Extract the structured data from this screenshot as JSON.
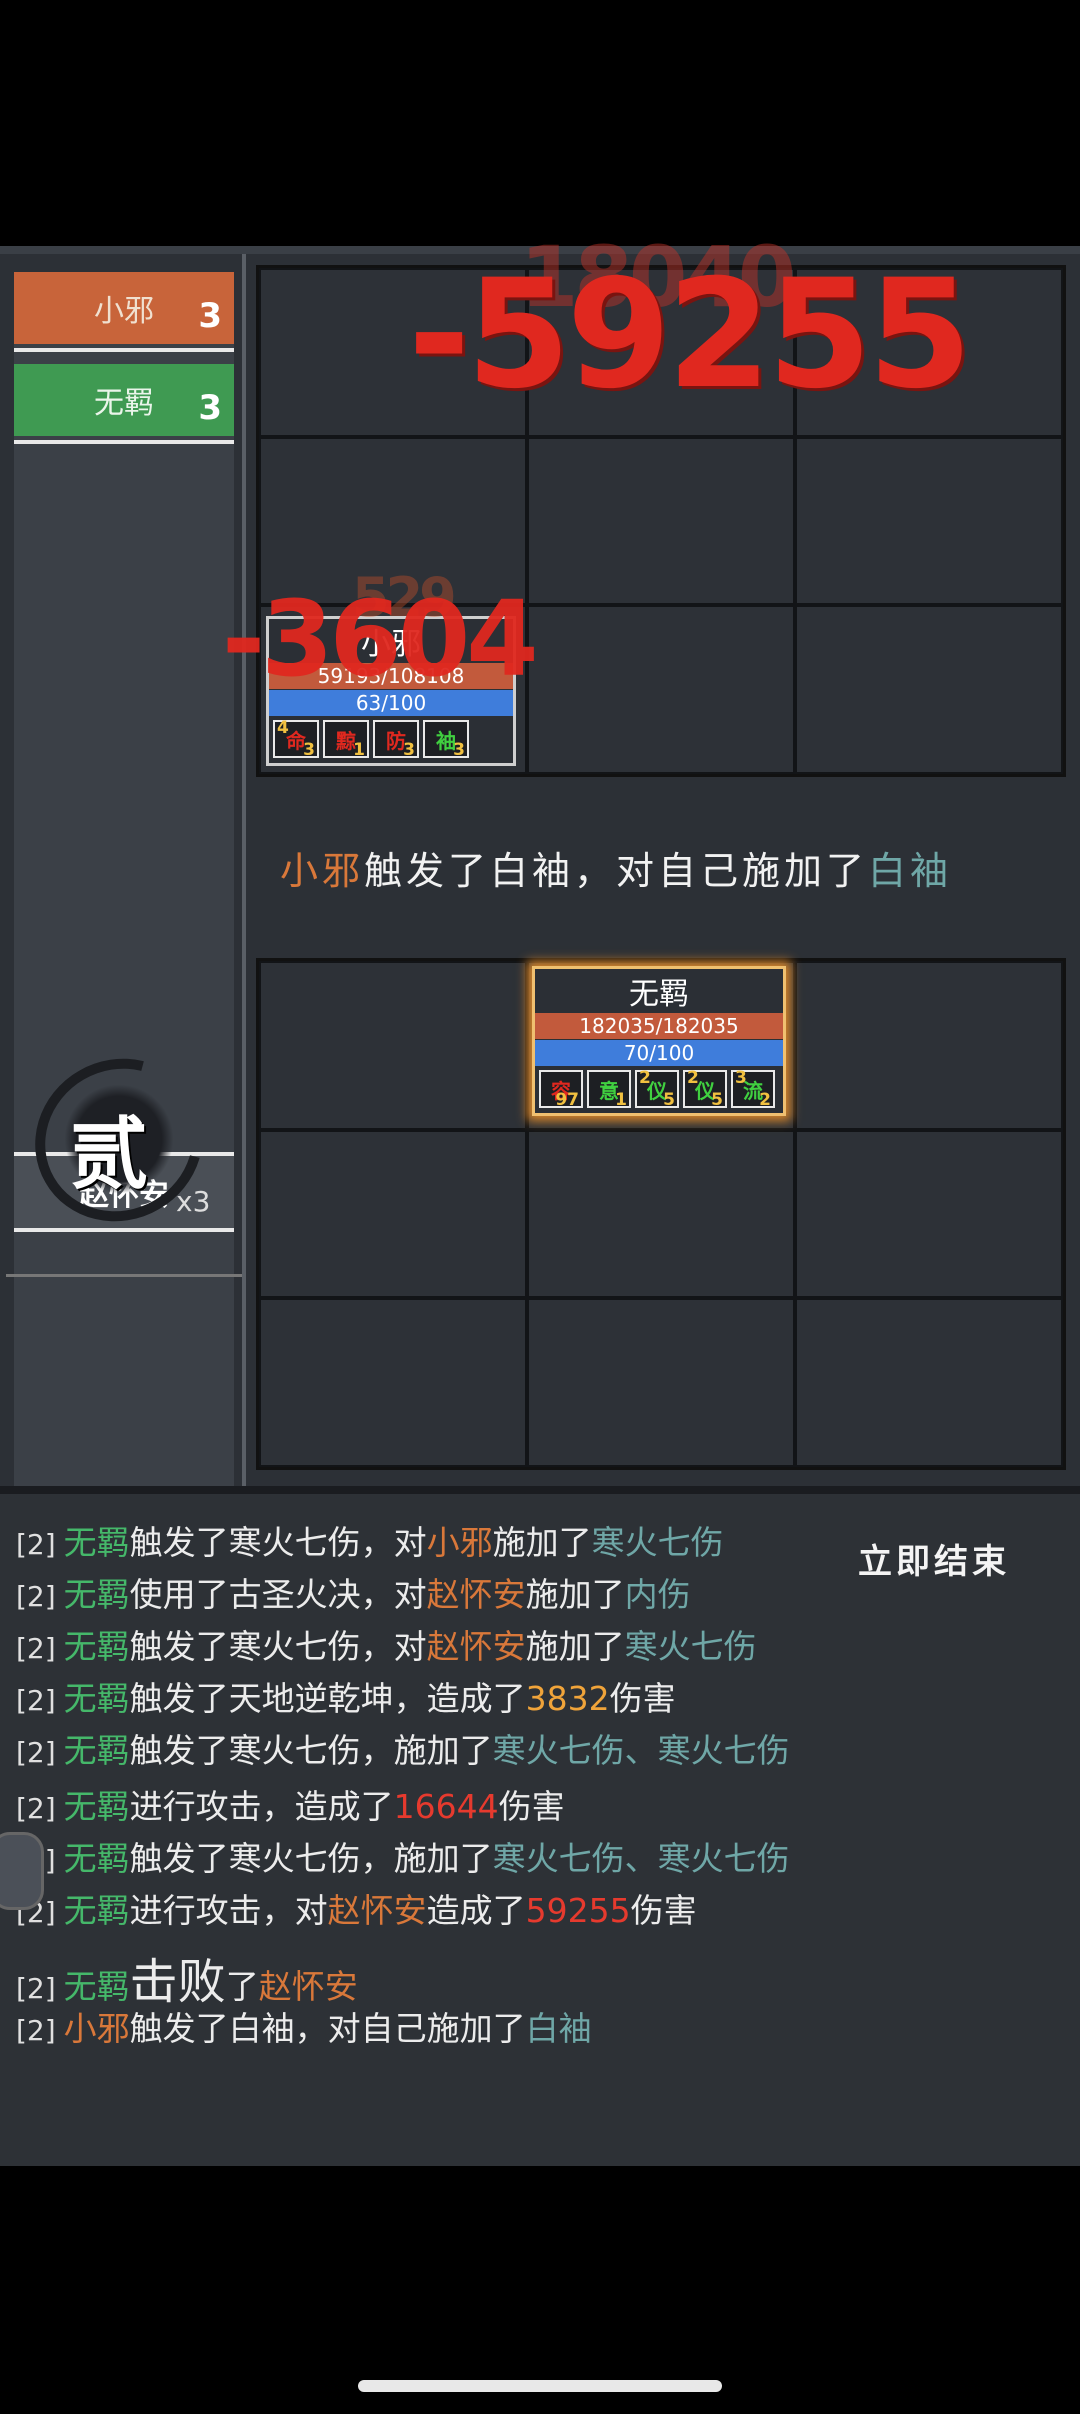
{
  "sidebar": {
    "teams": [
      {
        "name": "小邪",
        "count": "3",
        "color": "#c8643a"
      },
      {
        "name": "无羁",
        "count": "3",
        "color": "#3f9a52"
      }
    ],
    "target_button": "赵怀安",
    "round": {
      "char": "贰",
      "multiplier": "x3"
    }
  },
  "battlefield": {
    "damage_big": "-59255",
    "damage_big_ghost": "18040",
    "damage_small": "-3604",
    "damage_small_ghost": "529"
  },
  "units": {
    "enemy": {
      "name": "小邪",
      "hp": "59193/108108",
      "mp": "63/100",
      "buffs": [
        {
          "glyph": "命",
          "tl": "4",
          "br": "3",
          "color": "#e0281f"
        },
        {
          "glyph": "黥",
          "tl": "",
          "br": "1",
          "color": "#e0281f"
        },
        {
          "glyph": "防",
          "tl": "",
          "br": "3",
          "color": "#e0281f"
        },
        {
          "glyph": "袖",
          "tl": "",
          "br": "3",
          "color": "#40d040"
        }
      ]
    },
    "ally": {
      "name": "无羁",
      "hp": "182035/182035",
      "mp": "70/100",
      "buffs": [
        {
          "glyph": "容",
          "tl": "",
          "br": "97",
          "color": "#e0281f"
        },
        {
          "glyph": "意",
          "tl": "",
          "br": "1",
          "color": "#40d040"
        },
        {
          "glyph": "仪",
          "tl": "2",
          "br": "5",
          "color": "#40d040"
        },
        {
          "glyph": "仪",
          "tl": "2",
          "br": "5",
          "color": "#40d040"
        },
        {
          "glyph": "流",
          "tl": "3",
          "br": "2",
          "color": "#40d040"
        }
      ]
    }
  },
  "banner": {
    "actor": "小邪",
    "mid": "触发了白袖，对自己施加了",
    "effect": "白袖"
  },
  "log": {
    "end_button": "立即结束",
    "lines": [
      {
        "tag": "[2]",
        "a": "无羁",
        "b": "触发了寒火七伤，对",
        "c": "小邪",
        "d": "施加了",
        "e": "寒火七伤"
      },
      {
        "tag": "[2]",
        "a": "无羁",
        "b": "使用了古圣火决，对",
        "c": "赵怀安",
        "d": "施加了",
        "e": "内伤"
      },
      {
        "tag": "[2]",
        "a": "无羁",
        "b": "触发了寒火七伤，对",
        "c": "赵怀安",
        "d": "施加了",
        "e": "寒火七伤"
      },
      {
        "tag": "[2]",
        "a": "无羁",
        "b": "触发了天地逆乾坤，造成了",
        "c": "3832",
        "d": "伤害"
      },
      {
        "tag": "[2]",
        "a": "无羁",
        "b": "触发了寒火七伤，施加了",
        "c": "寒火七伤、寒火七伤"
      },
      {
        "tag": "[2]",
        "a": "无羁",
        "b": "进行攻击，造成了",
        "c": "16644",
        "d": "伤害"
      },
      {
        "tag": "[2]",
        "a": "无羁",
        "b": "触发了寒火七伤，施加了",
        "c": "寒火七伤、寒火七伤"
      },
      {
        "tag": "[2]",
        "a": "无羁",
        "b": "进行攻击，对",
        "c": "赵怀安",
        "d": "造成了",
        "e": "59255",
        "f": "伤害"
      },
      {
        "tag": "[2]",
        "a": "无羁",
        "b": "击败",
        "c": "了",
        "d": "赵怀安"
      },
      {
        "tag": "[2]",
        "a": "小邪",
        "b": "触发了白袖，对自己施加了",
        "c": "白袖"
      }
    ]
  }
}
